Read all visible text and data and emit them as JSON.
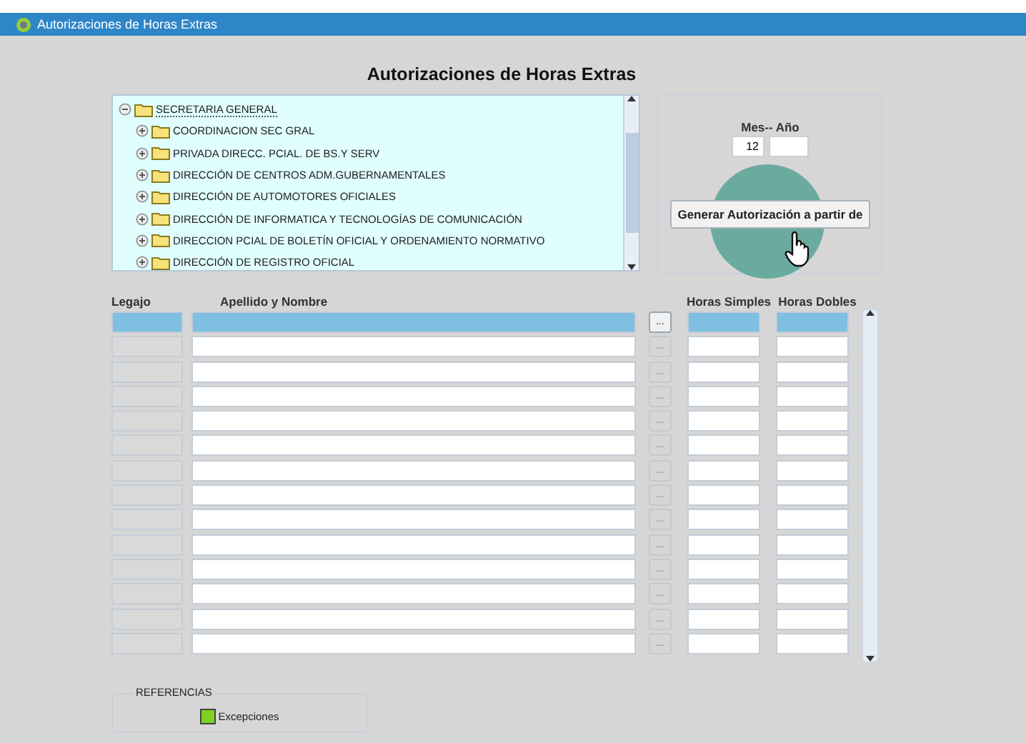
{
  "window": {
    "title": "Autorizaciones de Horas Extras"
  },
  "heading": "Autorizaciones de Horas Extras",
  "tree": {
    "label": "SECRETARIA GENERAL",
    "expanded": true,
    "children": [
      {
        "label": "COORDINACION SEC GRAL",
        "expanded": false
      },
      {
        "label": "PRIVADA DIRECC. PCIAL. DE BS.Y SERV",
        "expanded": false
      },
      {
        "label": "DIRECCIÓN DE CENTROS ADM.GUBERNAMENTALES",
        "expanded": false
      },
      {
        "label": "DIRECCIÓN DE AUTOMOTORES OFICIALES",
        "expanded": false
      },
      {
        "label": "DIRECCIÓN DE INFORMATICA Y TECNOLOGÍAS DE COMUNICACIÓN",
        "expanded": false
      },
      {
        "label": "DIRECCION PCIAL DE BOLETÍN OFICIAL Y ORDENAMIENTO NORMATIVO",
        "expanded": false
      },
      {
        "label": "DIRECCIÓN DE REGISTRO OFICIAL",
        "expanded": false
      }
    ]
  },
  "period": {
    "label": "Mes-- Año",
    "month": "12"
  },
  "generate_button": "Generar Autorización a partir de",
  "table": {
    "columns": [
      "Legajo",
      "Apellido y Nombre",
      "Horas Simples",
      "Horas Dobles"
    ],
    "lookup_button": "...",
    "rows": [
      {
        "selected": true
      },
      {
        "selected": false
      },
      {
        "selected": false
      },
      {
        "selected": false
      },
      {
        "selected": false
      },
      {
        "selected": false
      },
      {
        "selected": false
      },
      {
        "selected": false
      },
      {
        "selected": false
      },
      {
        "selected": false
      },
      {
        "selected": false
      },
      {
        "selected": false
      },
      {
        "selected": false
      },
      {
        "selected": false
      }
    ]
  },
  "references": {
    "title": "REFERENCIAS",
    "items": [
      {
        "label": "Excepciones",
        "color": "#7ed321"
      }
    ]
  }
}
